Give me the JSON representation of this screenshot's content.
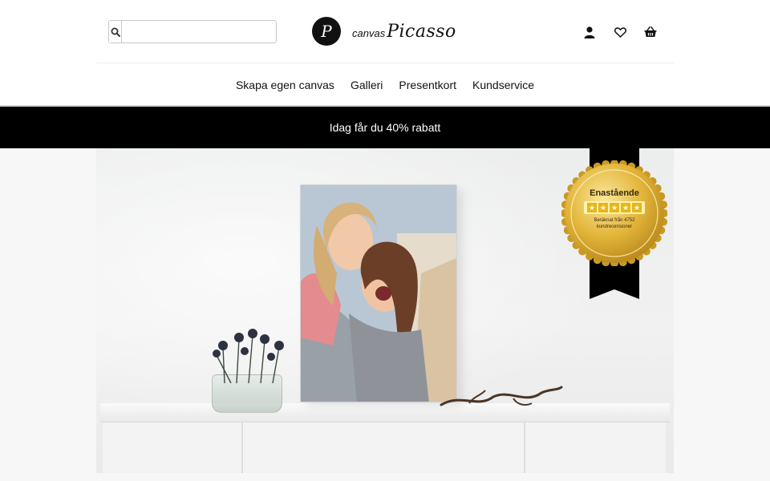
{
  "search": {
    "placeholder": "",
    "value": "",
    "icon": "search-icon"
  },
  "logo": {
    "mark_letter": "P",
    "small": "canvas",
    "big": "Picasso"
  },
  "header_icons": [
    "user-icon",
    "heart-icon",
    "basket-icon"
  ],
  "nav": {
    "items": [
      {
        "label": "Skapa egen canvas"
      },
      {
        "label": "Galleri"
      },
      {
        "label": "Presentkort"
      },
      {
        "label": "Kundservice"
      }
    ]
  },
  "promo": {
    "text": "Idag får du 40% rabatt"
  },
  "badge": {
    "title": "Enastående",
    "stars": 5,
    "star_glyph": "★",
    "subtitle": "Beräknat från 4752 kundrecensioner"
  },
  "colors": {
    "promo_bg": "#000000",
    "badge_gold": "#d8a924",
    "ribbon": "#000000"
  }
}
